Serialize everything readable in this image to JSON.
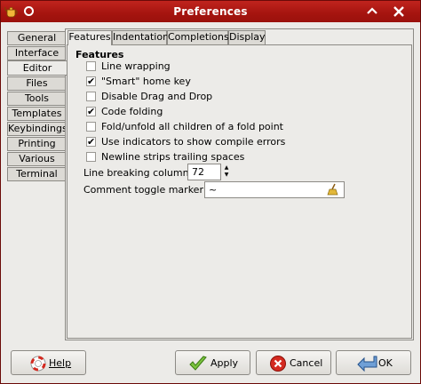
{
  "window": {
    "title": "Preferences",
    "app_icon": "geany-teapot-icon",
    "titlebar_color": "#a5140f"
  },
  "categories": [
    {
      "label": "General",
      "active": false
    },
    {
      "label": "Interface",
      "active": false
    },
    {
      "label": "Editor",
      "active": true
    },
    {
      "label": "Files",
      "active": false
    },
    {
      "label": "Tools",
      "active": false
    },
    {
      "label": "Templates",
      "active": false
    },
    {
      "label": "Keybindings",
      "active": false
    },
    {
      "label": "Printing",
      "active": false
    },
    {
      "label": "Various",
      "active": false
    },
    {
      "label": "Terminal",
      "active": false
    }
  ],
  "subtabs": [
    {
      "label": "Features",
      "active": true
    },
    {
      "label": "Indentation",
      "active": false
    },
    {
      "label": "Completions",
      "active": false
    },
    {
      "label": "Display",
      "active": false
    }
  ],
  "features": {
    "heading": "Features",
    "options": [
      {
        "label": "Line wrapping",
        "checked": false
      },
      {
        "label": "\"Smart\" home key",
        "checked": true
      },
      {
        "label": "Disable Drag and Drop",
        "checked": false
      },
      {
        "label": "Code folding",
        "checked": true
      },
      {
        "label": "Fold/unfold all children of a fold point",
        "checked": false
      },
      {
        "label": "Use indicators to show compile errors",
        "checked": true
      },
      {
        "label": "Newline strips trailing spaces",
        "checked": false
      }
    ],
    "line_breaking": {
      "label": "Line breaking column:",
      "value": "72"
    },
    "comment_marker": {
      "label": "Comment toggle marker:",
      "value": "~"
    }
  },
  "buttons": {
    "help": "Help",
    "apply": "Apply",
    "cancel": "Cancel",
    "ok": "OK"
  }
}
